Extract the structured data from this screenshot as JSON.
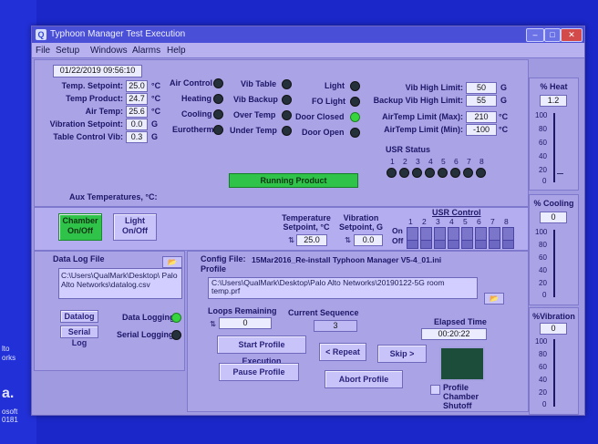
{
  "desktop": {
    "side_labels": [
      "lto",
      "orks",
      "a.",
      "osoft",
      "0181"
    ]
  },
  "window": {
    "title": "Typhoon Manager Test Execution",
    "menu": [
      "File",
      "Setup",
      "Windows",
      "Alarms",
      "Help"
    ],
    "controls": {
      "minimize": "–",
      "maximize": "□",
      "close": "✕"
    }
  },
  "status_panel": {
    "datetime": "01/22/2019 09:56:10",
    "temp_setpoint": {
      "label": "Temp. Setpoint:",
      "value": "25.0",
      "unit": "°C"
    },
    "temp_product": {
      "label": "Temp Product:",
      "value": "24.7",
      "unit": "°C"
    },
    "air_temp": {
      "label": "Air Temp:",
      "value": "25.6",
      "unit": "°C"
    },
    "vibration_setpoint": {
      "label": "Vibration Setpoint:",
      "value": "0.0",
      "unit": "G"
    },
    "table_control_vib": {
      "label": "Table Control Vib:",
      "value": "0.3",
      "unit": "G"
    },
    "aux_temps_label": "Aux Temperatures, °C:",
    "running_text": "Running Product"
  },
  "indicators": {
    "col1": [
      {
        "label": "Air Control",
        "on": false
      },
      {
        "label": "Heating",
        "on": false
      },
      {
        "label": "Cooling",
        "on": false
      },
      {
        "label": "Eurotherm",
        "on": false
      }
    ],
    "col2": [
      {
        "label": "Vib Table",
        "on": false
      },
      {
        "label": "Vib Backup",
        "on": false
      },
      {
        "label": "Over Temp",
        "on": false
      },
      {
        "label": "Under Temp",
        "on": false
      }
    ],
    "col3": [
      {
        "label": "Light",
        "on": false
      },
      {
        "label": "FO Light",
        "on": false
      },
      {
        "label": "Door Closed",
        "on": true
      },
      {
        "label": "Door Open",
        "on": false
      }
    ]
  },
  "limits": {
    "vib_high": {
      "label": "Vib High Limit:",
      "value": "50",
      "unit": "G"
    },
    "backup_vib_high": {
      "label": "Backup Vib High Limit:",
      "value": "55",
      "unit": "G"
    },
    "airtemp_max": {
      "label": "AirTemp Limit (Max):",
      "value": "210",
      "unit": "°C"
    },
    "airtemp_min": {
      "label": "AirTemp Limit (Min):",
      "value": "-100",
      "unit": "°C"
    }
  },
  "usr_status": {
    "title": "USR Status",
    "numbers": [
      "1",
      "2",
      "3",
      "4",
      "5",
      "6",
      "7",
      "8"
    ]
  },
  "controls": {
    "chamber_btn": "Chamber On/Off",
    "light_btn": "Light On/Off",
    "temperature_setpoint_label": "Temperature Setpoint, °C",
    "temperature_setpoint_value": "25.0",
    "vibration_setpoint_label": "Vibration Setpoint, G",
    "vibration_setpoint_value": "0.0",
    "usr_control_title": "USR Control",
    "usr_on": "On",
    "usr_off": "Off",
    "usr_numbers": [
      "1",
      "2",
      "3",
      "4",
      "5",
      "6",
      "7",
      "8"
    ]
  },
  "datalog": {
    "title": "Data Log File",
    "path": "C:\\Users\\QualMark\\Desktop\\ Palo Alto Networks\\datalog.csv",
    "datalog_btn": "Datalog",
    "serial_log_btn": "Serial Log",
    "data_logging_label": "Data Logging",
    "serial_logging_label": "Serial Logging"
  },
  "profile": {
    "config_label": "Config File:",
    "config_value": "15Mar2016_Re-install Typhoon Manager V5-4_01.ini",
    "profile_label": "Profile",
    "profile_path": "C:\\Users\\QualMark\\Desktop\\Palo Alto Networks\\20190122-5G room temp.prf",
    "loops_remaining_label": "Loops Remaining",
    "loops_remaining_value": "0",
    "current_sequence_label": "Current Sequence",
    "current_sequence_value": "3",
    "elapsed_time_label": "Elapsed Time",
    "elapsed_time_value": "00:20:22",
    "start_btn": "Start Profile Execution",
    "repeat_btn": "< Repeat",
    "skip_btn": "Skip >",
    "pause_btn": "Pause Profile",
    "abort_btn": "Abort Profile",
    "chamber_shutoff": "Profile Chamber Shutoff"
  },
  "gauges": {
    "heat": {
      "title": "% Heat",
      "value": "1.2",
      "ticks": [
        "100",
        "80",
        "60",
        "40",
        "20",
        "0"
      ]
    },
    "cooling": {
      "title": "% Cooling",
      "value": "0",
      "ticks": [
        "100",
        "80",
        "60",
        "40",
        "20",
        "0"
      ]
    },
    "vibration": {
      "title": "%Vibration",
      "value": "0",
      "ticks": [
        "100",
        "80",
        "60",
        "40",
        "20",
        "0"
      ]
    }
  }
}
